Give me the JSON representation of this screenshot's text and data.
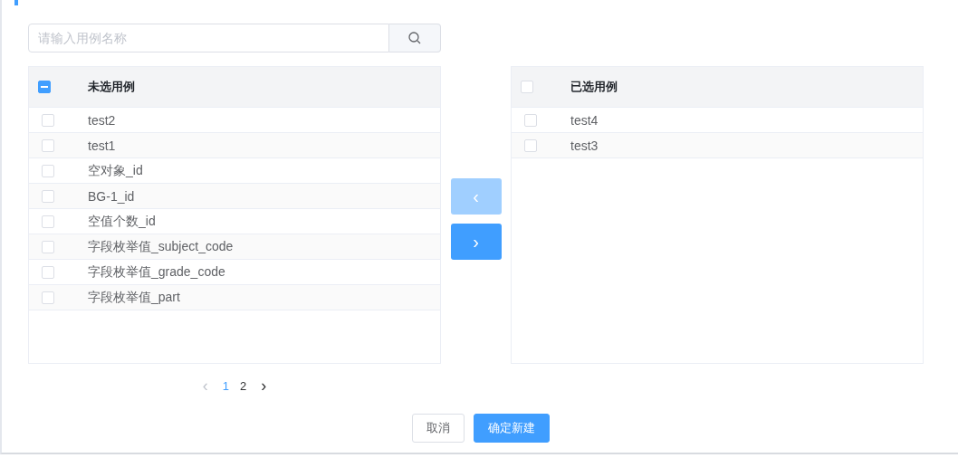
{
  "search": {
    "placeholder": "请输入用例名称"
  },
  "unselected_panel": {
    "title": "未选用例",
    "header_indeterminate": true,
    "items": [
      {
        "label": "test2",
        "checked": false
      },
      {
        "label": "test1",
        "checked": false
      },
      {
        "label": "空对象_id",
        "checked": false
      },
      {
        "label": "BG-1_id",
        "checked": false
      },
      {
        "label": "空值个数_id",
        "checked": false
      },
      {
        "label": "字段枚举值_subject_code",
        "checked": false
      },
      {
        "label": "字段枚举值_grade_code",
        "checked": false
      },
      {
        "label": "字段枚举值_part",
        "checked": false
      }
    ]
  },
  "transfer_buttons": [
    {
      "symbol": "‹",
      "disabled": true
    },
    {
      "symbol": "›",
      "disabled": false
    }
  ],
  "selected_panel": {
    "title": "已选用例",
    "header_indeterminate": false,
    "items": [
      {
        "label": "test4",
        "checked": false
      },
      {
        "label": "test3",
        "checked": false
      }
    ]
  },
  "pagination": {
    "prev": "‹",
    "next": "›",
    "pages": [
      {
        "label": "1",
        "selected": true
      },
      {
        "label": "2",
        "selected": false
      }
    ]
  },
  "buttons": [
    {
      "label": "取消",
      "kind": "secondary"
    },
    {
      "label": "确定新建",
      "kind": "primary"
    }
  ]
}
